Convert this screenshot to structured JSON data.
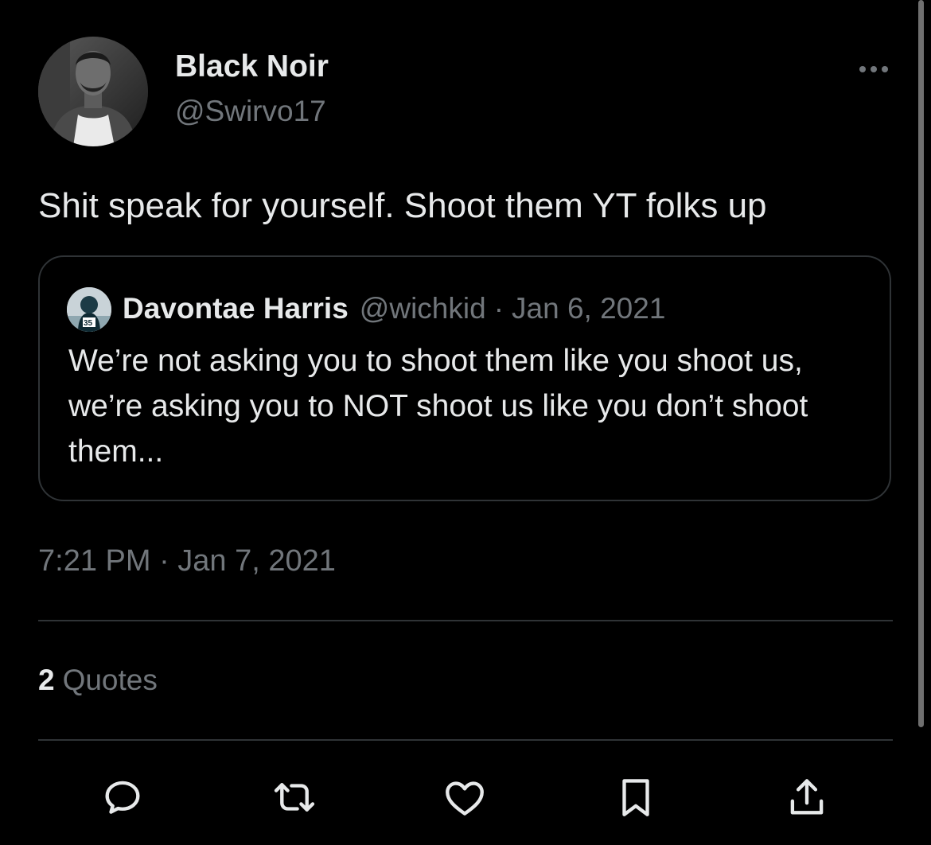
{
  "tweet": {
    "author": {
      "display_name": "Black Noir",
      "handle": "@Swirvo17"
    },
    "text": "Shit speak for yourself. Shoot them YT folks up",
    "quoted": {
      "display_name": "Davontae Harris",
      "handle": "@wichkid",
      "separator": "·",
      "date": "Jan 6, 2021",
      "text": "We’re not asking you to shoot them like you shoot us, we’re asking you to NOT shoot us like you don’t shoot them..."
    },
    "timestamp": "7:21 PM · Jan 7, 2021",
    "stats": {
      "quotes_count": "2",
      "quotes_label": "Quotes"
    }
  },
  "icons": {
    "more": "more-dots-icon",
    "reply": "reply-icon",
    "retweet": "retweet-icon",
    "like": "heart-icon",
    "bookmark": "bookmark-icon",
    "share": "share-icon"
  },
  "colors": {
    "background": "#000000",
    "primary_text": "#e7e9ea",
    "secondary_text": "#71767b",
    "border": "#2f3336"
  }
}
